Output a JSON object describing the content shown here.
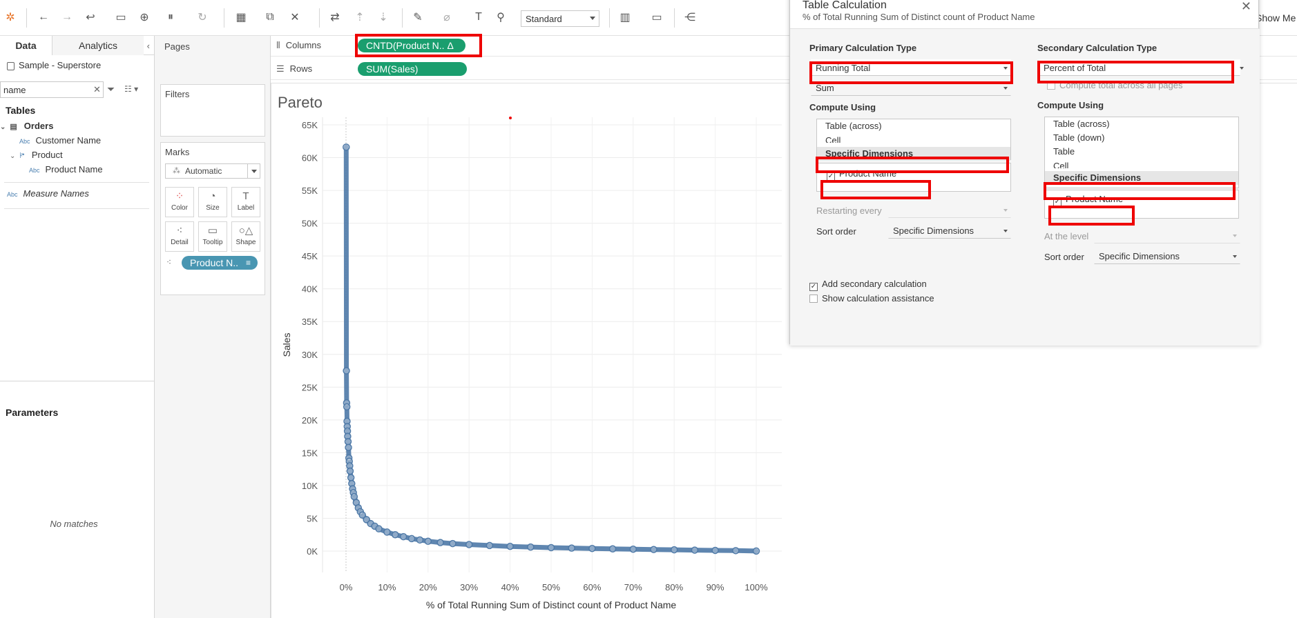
{
  "toolbar": {
    "view_mode": "Standard",
    "show_me": "Show Me"
  },
  "data_pane": {
    "tab_data": "Data",
    "tab_analytics": "Analytics",
    "datasource": "Sample - Superstore",
    "search_value": "name",
    "tables_heading": "Tables",
    "tree": [
      {
        "label": "Orders",
        "kind": "table"
      },
      {
        "label": "Customer Name",
        "kind": "dimension"
      },
      {
        "label": "Product",
        "kind": "hierarchy"
      },
      {
        "label": "Product Name",
        "kind": "dimension"
      },
      {
        "label": "Measure Names",
        "kind": "measure-names"
      }
    ],
    "parameters_heading": "Parameters",
    "no_matches": "No matches"
  },
  "cards": {
    "pages": "Pages",
    "filters": "Filters",
    "marks": "Marks",
    "mark_type": "Automatic",
    "buttons": [
      "Color",
      "Size",
      "Label",
      "Detail",
      "Tooltip",
      "Shape"
    ],
    "detail_pill": "Product N.."
  },
  "shelves": {
    "columns_label": "Columns",
    "rows_label": "Rows",
    "columns_pill": "CNTD(Product N.. Δ",
    "rows_pill": "SUM(Sales)"
  },
  "viz": {
    "title": "Pareto"
  },
  "chart_data": {
    "type": "scatter",
    "title": "Pareto",
    "xlabel": "% of Total Running Sum of Distinct count of Product Name",
    "ylabel": "Sales",
    "x_ticks": [
      "0%",
      "10%",
      "20%",
      "30%",
      "40%",
      "50%",
      "60%",
      "70%",
      "80%",
      "90%",
      "100%"
    ],
    "y_ticks": [
      "0K",
      "5K",
      "10K",
      "15K",
      "20K",
      "25K",
      "30K",
      "35K",
      "40K",
      "45K",
      "50K",
      "55K",
      "60K",
      "65K"
    ],
    "xlim": [
      0,
      100
    ],
    "ylim": [
      0,
      65000
    ],
    "grid": true,
    "mark_color": "#4e79a7",
    "points": [
      [
        0.05,
        61600
      ],
      [
        0.1,
        27500
      ],
      [
        0.15,
        22600
      ],
      [
        0.2,
        22000
      ],
      [
        0.25,
        19800
      ],
      [
        0.3,
        19000
      ],
      [
        0.35,
        18300
      ],
      [
        0.4,
        17500
      ],
      [
        0.5,
        16700
      ],
      [
        0.6,
        15800
      ],
      [
        0.7,
        14200
      ],
      [
        0.8,
        13700
      ],
      [
        0.9,
        13000
      ],
      [
        1.0,
        12200
      ],
      [
        1.2,
        11200
      ],
      [
        1.4,
        10300
      ],
      [
        1.6,
        9500
      ],
      [
        1.8,
        8900
      ],
      [
        2.0,
        8300
      ],
      [
        2.5,
        7400
      ],
      [
        3.0,
        6600
      ],
      [
        3.5,
        6000
      ],
      [
        4.0,
        5500
      ],
      [
        5.0,
        4800
      ],
      [
        6.0,
        4200
      ],
      [
        7.0,
        3800
      ],
      [
        8.0,
        3400
      ],
      [
        10.0,
        2900
      ],
      [
        12.0,
        2500
      ],
      [
        14.0,
        2200
      ],
      [
        16.0,
        1900
      ],
      [
        18.0,
        1700
      ],
      [
        20.0,
        1500
      ],
      [
        23.0,
        1300
      ],
      [
        26.0,
        1150
      ],
      [
        30.0,
        1000
      ],
      [
        35.0,
        850
      ],
      [
        40.0,
        720
      ],
      [
        45.0,
        620
      ],
      [
        50.0,
        530
      ],
      [
        55.0,
        460
      ],
      [
        60.0,
        400
      ],
      [
        65.0,
        340
      ],
      [
        70.0,
        290
      ],
      [
        75.0,
        240
      ],
      [
        80.0,
        200
      ],
      [
        85.0,
        150
      ],
      [
        90.0,
        110
      ],
      [
        95.0,
        70
      ],
      [
        100.0,
        10
      ]
    ]
  },
  "dialog": {
    "title": "Table Calculation",
    "subtitle": "% of Total Running Sum of Distinct count of Product Name",
    "primary": {
      "heading": "Primary Calculation Type",
      "type": "Running Total",
      "aggregation": "Sum",
      "compute_using": "Compute Using",
      "options": [
        "Table (across)",
        "Cell",
        "Specific Dimensions"
      ],
      "selected": "Specific Dimensions",
      "dimension": "Product Name",
      "restarting_label": "Restarting every",
      "sort_label": "Sort order",
      "sort_value": "Specific Dimensions"
    },
    "secondary": {
      "heading": "Secondary Calculation Type",
      "type": "Percent of Total",
      "compute_total": "Compute total across all pages",
      "compute_using": "Compute Using",
      "options": [
        "Table (across)",
        "Table (down)",
        "Table",
        "Cell",
        "Specific Dimensions"
      ],
      "selected": "Specific Dimensions",
      "dimension": "Product Name",
      "level_label": "At the level",
      "sort_label": "Sort order",
      "sort_value": "Specific Dimensions"
    },
    "add_secondary": "Add secondary calculation",
    "show_assistance": "Show calculation assistance"
  },
  "colors": {
    "highlight": "#e00000",
    "pill_green": "#1a9e6e",
    "pill_blue": "#4996b2"
  }
}
